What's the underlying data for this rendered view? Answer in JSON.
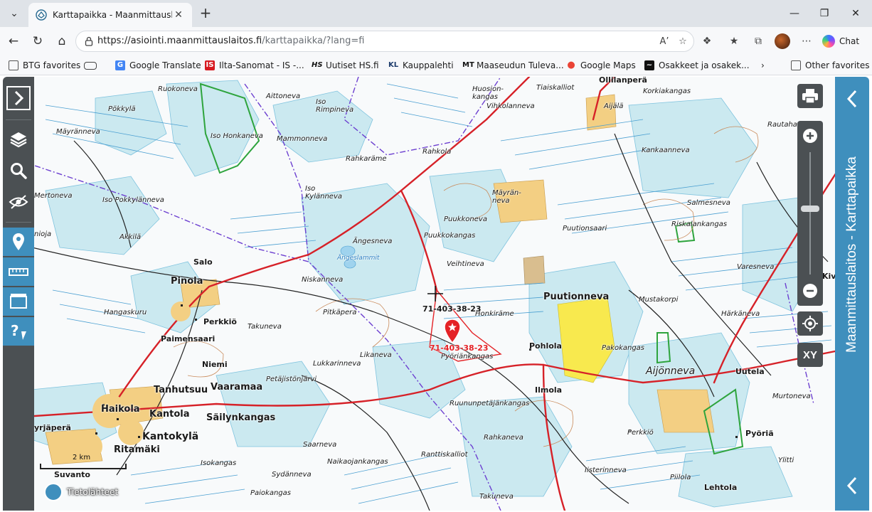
{
  "browser": {
    "tab": {
      "title": "Karttapaikka - Maanmittauslaitos"
    },
    "address": {
      "host": "https://asiointi.maanmittauslaitos.fi",
      "path": "/karttapaikka/?lang=fi"
    },
    "chat_label": "Chat",
    "favorites": [
      {
        "label": "BTG favorites"
      },
      {
        "label": ""
      },
      {
        "label": "Google Translate"
      },
      {
        "label": "Ilta-Sanomat - IS -..."
      },
      {
        "label": "Uutiset  HS.fi"
      },
      {
        "label": "Kauppalehti"
      },
      {
        "label": "Maaseudun Tuleva..."
      },
      {
        "label": "Google Maps"
      },
      {
        "label": "Osakkeet ja osakek..."
      },
      {
        "label": "Other favorites"
      }
    ],
    "fav_icon_text": {
      "is": "IS",
      "hs": "HS",
      "kl": "KL",
      "mt": "MT"
    }
  },
  "app": {
    "side_title": "Maanmittauslaitos - Karttapaikka",
    "xy_label": "XY",
    "scale_label": "2 km",
    "sources_label": "Tietolähteet",
    "parcel_label": "71-403-38-23",
    "colors": {
      "panel_blue": "#3f8fbd",
      "toolbar_dark": "#4b5053",
      "road_red": "#d62128",
      "marker_red": "#e42226"
    }
  },
  "map": {
    "places": [
      {
        "t": "Ruokoneva"
      },
      {
        "t": "Aittoneva"
      },
      {
        "t": "Pökkylä"
      },
      {
        "t": "Iso Rimpineva"
      },
      {
        "t": "Huosion-kangas"
      },
      {
        "t": "Tiaiskalliot"
      },
      {
        "t": "Ollilanperä"
      },
      {
        "t": "Korkiakangas"
      },
      {
        "t": "Mäyränneva"
      },
      {
        "t": "Iso Honkaneva"
      },
      {
        "t": "Mammonneva"
      },
      {
        "t": "Vihkolanneva"
      },
      {
        "t": "Aijälä"
      },
      {
        "t": "Rautaharju"
      },
      {
        "t": "Rahkola"
      },
      {
        "t": "Rahkaräme"
      },
      {
        "t": "Kankaanneva"
      },
      {
        "t": "Iso Pokkylänneva"
      },
      {
        "t": "Mertoneva"
      },
      {
        "t": "Iso Kylänneva"
      },
      {
        "t": "Mäyrän-neva"
      },
      {
        "t": "Salmesneva"
      },
      {
        "t": "Akkilä"
      },
      {
        "t": "Ängesneva"
      },
      {
        "t": "Puukkoneva"
      },
      {
        "t": "Puukkokangas"
      },
      {
        "t": "Puutionsaari"
      },
      {
        "t": "Riskalankangas"
      },
      {
        "t": "Salo"
      },
      {
        "t": "Veihtineva"
      },
      {
        "t": "Varesneva"
      },
      {
        "t": "Pinola"
      },
      {
        "t": "Niskanneva"
      },
      {
        "t": "Puutionneva"
      },
      {
        "t": "Mustakorpi"
      },
      {
        "t": "Hangaskuru"
      },
      {
        "t": "Pitkäpera"
      },
      {
        "t": "Honkiräme"
      },
      {
        "t": "Härkäneva"
      },
      {
        "t": "Perkkiö"
      },
      {
        "t": "Paimensaari"
      },
      {
        "t": "Takuneva"
      },
      {
        "t": "Pohlola"
      },
      {
        "t": "Pakokangas"
      },
      {
        "t": "Pyöriänkangas"
      },
      {
        "t": "Likaneva"
      },
      {
        "t": "Niemi"
      },
      {
        "t": "Lukkarinneva"
      },
      {
        "t": "Uutela"
      },
      {
        "t": "Petäjistönjärvi"
      },
      {
        "t": "Tanhutsuu"
      },
      {
        "t": "Vaaramaa"
      },
      {
        "t": "Ilmola"
      },
      {
        "t": "Murtoneva"
      },
      {
        "t": "Aijönneva"
      },
      {
        "t": "Haikola"
      },
      {
        "t": "Kantola"
      },
      {
        "t": "Säilynkangas"
      },
      {
        "t": "Ruununpetäjänkangas"
      },
      {
        "t": "yrjäperä"
      },
      {
        "t": "Kantokylä"
      },
      {
        "t": "Perkkiö"
      },
      {
        "t": "Pyöriä"
      },
      {
        "t": "Saarneva"
      },
      {
        "t": "Rahkaneva"
      },
      {
        "t": "Ritamäki"
      },
      {
        "t": "Naikaojankangas"
      },
      {
        "t": "Ylitti"
      },
      {
        "t": "Suvanto"
      },
      {
        "t": "Isokangas"
      },
      {
        "t": "Ranttiskalliot"
      },
      {
        "t": "Iisterinneva"
      },
      {
        "t": "Sydänneva"
      },
      {
        "t": "Piilola"
      },
      {
        "t": "Paiokangas"
      },
      {
        "t": "Lehtola"
      },
      {
        "t": "Takuneva"
      },
      {
        "t": "Ängeslammit"
      },
      {
        "t": "Kivi"
      },
      {
        "t": "nioja"
      }
    ]
  }
}
